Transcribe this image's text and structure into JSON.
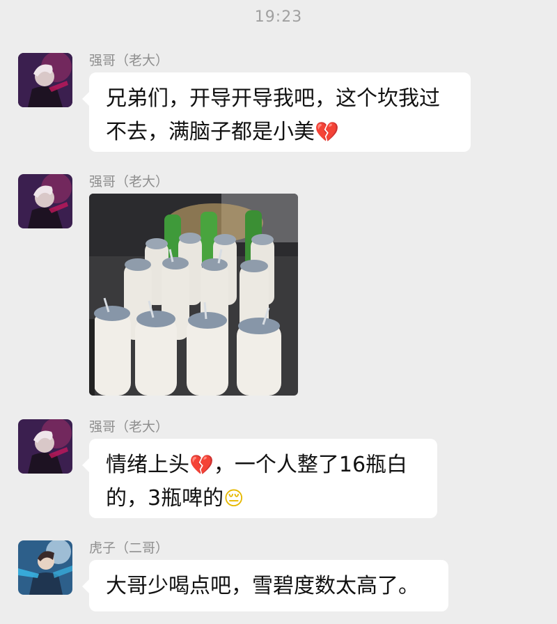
{
  "chat": {
    "timestamp": "19:23",
    "messages": [
      {
        "sender": "强哥（老大）",
        "avatar": "dark-hero-avatar",
        "lines": [
          "兄弟们，开导开导我吧，这个坎我过",
          "不去，满脑子都是小美"
        ],
        "emoji": "💔",
        "emoji_icon": "broken-heart-icon"
      },
      {
        "sender": "强哥（老大）",
        "avatar": "dark-hero-avatar",
        "image": "photo-of-bottles"
      },
      {
        "sender": "强哥（老大）",
        "avatar": "dark-hero-avatar",
        "line1_a": "情绪上头",
        "line1_emoji": "💔",
        "line1_b": "，一个人整了16瓶白",
        "line2": "的，3瓶啤的",
        "line2_emoji": "😔"
      },
      {
        "sender": "虎子（二哥）",
        "avatar": "blue-warrior-avatar",
        "lines": [
          "大哥少喝点吧，雪碧度数太高了。"
        ]
      }
    ]
  },
  "colors": {
    "background": "#ededed",
    "bubble": "#ffffff",
    "sender_text": "#8e8e8e",
    "timestamp_text": "#a0a0a0"
  }
}
